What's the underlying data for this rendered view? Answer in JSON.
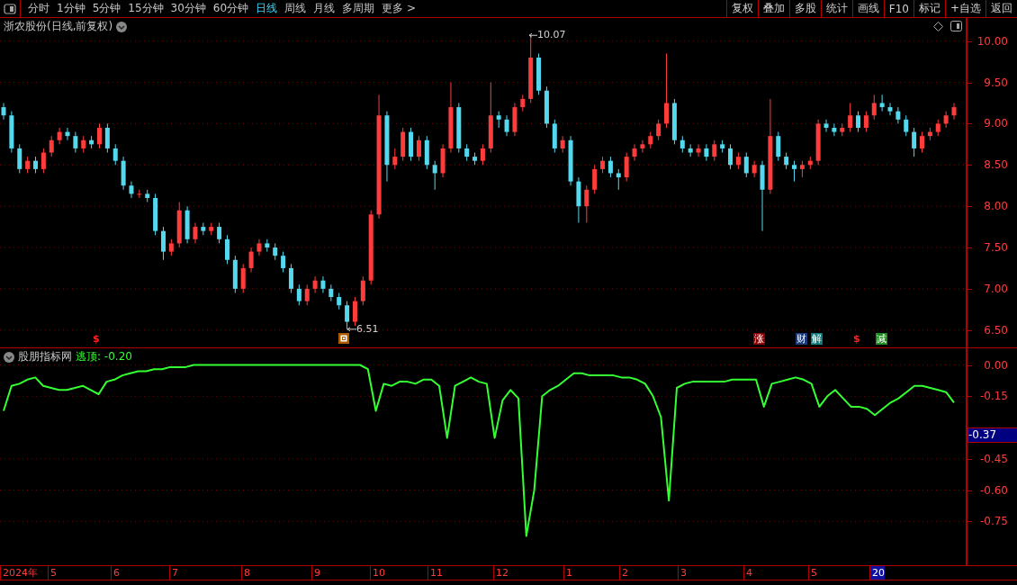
{
  "toolbar": {
    "tabs": [
      {
        "label": "分时",
        "selected": false
      },
      {
        "label": "1分钟",
        "selected": false
      },
      {
        "label": "5分钟",
        "selected": false
      },
      {
        "label": "15分钟",
        "selected": false
      },
      {
        "label": "30分钟",
        "selected": false
      },
      {
        "label": "60分钟",
        "selected": false
      },
      {
        "label": "日线",
        "selected": true
      },
      {
        "label": "周线",
        "selected": false
      },
      {
        "label": "月线",
        "selected": false
      },
      {
        "label": "多周期",
        "selected": false
      },
      {
        "label": "更多 >",
        "selected": false
      }
    ],
    "buttons": [
      "复权",
      "叠加",
      "多股",
      "统计",
      "画线",
      "F10",
      "标记",
      "+自选",
      "返回"
    ]
  },
  "price_panel": {
    "title": "浙农股份(日线,前复权)",
    "high_label": "10.07",
    "low_label": "6.51",
    "markers": [
      {
        "kind": "dollar",
        "text": "$"
      },
      {
        "kind": "box"
      },
      {
        "kind": "tag",
        "text": "涨",
        "color": "#8b0000"
      },
      {
        "kind": "tag",
        "text": "财",
        "color": "#1a3a7a"
      },
      {
        "kind": "tag",
        "text": "解",
        "color": "#0e7a7a"
      },
      {
        "kind": "dollar",
        "text": "$"
      },
      {
        "kind": "tag",
        "text": "减",
        "color": "#1e8a1e"
      }
    ],
    "chart_data": {
      "type": "candlestick",
      "ylim": [
        6.29,
        10.28
      ],
      "grid": true,
      "yticks": [
        {
          "value": 10,
          "label": "10.00"
        },
        {
          "value": 9.5,
          "label": "9.50"
        },
        {
          "value": 9,
          "label": "9.00"
        },
        {
          "value": 8.5,
          "label": "8.50"
        },
        {
          "value": 8,
          "label": "8.00"
        },
        {
          "value": 7.5,
          "label": "7.50"
        },
        {
          "value": 7,
          "label": "7.00"
        },
        {
          "value": 6.5,
          "label": "6.50"
        }
      ],
      "categories": [
        null,
        null,
        null,
        null,
        null,
        null,
        null,
        null,
        null,
        null,
        null,
        null,
        null,
        null,
        null,
        null,
        null,
        null,
        null,
        null,
        null,
        null,
        null,
        null,
        null,
        null,
        null,
        null,
        null,
        null,
        null,
        null,
        null,
        null,
        null,
        null,
        null,
        null,
        null,
        null,
        null,
        null,
        null,
        null,
        null,
        null,
        null,
        null,
        null,
        null,
        null,
        null,
        null,
        null,
        null,
        null,
        null,
        null,
        null,
        null,
        null,
        null,
        null,
        null,
        null,
        null,
        null,
        null,
        null,
        null,
        null,
        null,
        null,
        null,
        null,
        null,
        null,
        null,
        null,
        null,
        null,
        null,
        null,
        null,
        null,
        null,
        null,
        null,
        null,
        null,
        null,
        null,
        null,
        null,
        null,
        null,
        null,
        null,
        null,
        null,
        null,
        null,
        null,
        null,
        null,
        null,
        null,
        null,
        null,
        null,
        null,
        null,
        null,
        null,
        null,
        null,
        null,
        null,
        null,
        null
      ],
      "ohlc": [
        [
          9.2,
          9.25,
          9.05,
          9.1
        ],
        [
          9.1,
          9.15,
          8.65,
          8.7
        ],
        [
          8.7,
          8.75,
          8.4,
          8.45
        ],
        [
          8.45,
          8.6,
          8.4,
          8.55
        ],
        [
          8.55,
          8.6,
          8.4,
          8.45
        ],
        [
          8.45,
          8.7,
          8.4,
          8.65
        ],
        [
          8.65,
          8.85,
          8.6,
          8.8
        ],
        [
          8.8,
          8.95,
          8.75,
          8.9
        ],
        [
          8.9,
          8.95,
          8.8,
          8.85
        ],
        [
          8.85,
          8.9,
          8.65,
          8.7
        ],
        [
          8.7,
          8.85,
          8.65,
          8.8
        ],
        [
          8.8,
          8.85,
          8.7,
          8.75
        ],
        [
          8.75,
          9.0,
          8.7,
          8.95
        ],
        [
          8.95,
          9.0,
          8.65,
          8.7
        ],
        [
          8.7,
          8.75,
          8.5,
          8.55
        ],
        [
          8.55,
          8.6,
          8.2,
          8.25
        ],
        [
          8.25,
          8.3,
          8.1,
          8.15
        ],
        [
          8.15,
          8.2,
          8.1,
          8.15
        ],
        [
          8.15,
          8.2,
          8.05,
          8.1
        ],
        [
          8.1,
          8.15,
          7.65,
          7.7
        ],
        [
          7.7,
          7.75,
          7.35,
          7.45
        ],
        [
          7.45,
          7.6,
          7.4,
          7.55
        ],
        [
          7.55,
          8.05,
          7.5,
          7.95
        ],
        [
          7.95,
          8.0,
          7.55,
          7.6
        ],
        [
          7.6,
          7.8,
          7.55,
          7.75
        ],
        [
          7.75,
          7.8,
          7.65,
          7.7
        ],
        [
          7.7,
          7.8,
          7.65,
          7.75
        ],
        [
          7.75,
          7.8,
          7.55,
          7.6
        ],
        [
          7.6,
          7.65,
          7.3,
          7.35
        ],
        [
          7.35,
          7.4,
          6.95,
          7.0
        ],
        [
          7.0,
          7.3,
          6.95,
          7.25
        ],
        [
          7.25,
          7.5,
          7.2,
          7.45
        ],
        [
          7.45,
          7.6,
          7.4,
          7.55
        ],
        [
          7.55,
          7.6,
          7.45,
          7.5
        ],
        [
          7.5,
          7.55,
          7.35,
          7.4
        ],
        [
          7.4,
          7.45,
          7.2,
          7.25
        ],
        [
          7.25,
          7.3,
          6.95,
          7.0
        ],
        [
          7.0,
          7.05,
          6.8,
          6.85
        ],
        [
          6.85,
          7.05,
          6.8,
          7.0
        ],
        [
          7.0,
          7.15,
          6.95,
          7.1
        ],
        [
          7.1,
          7.15,
          6.95,
          7.0
        ],
        [
          7.0,
          7.05,
          6.85,
          6.9
        ],
        [
          6.9,
          6.95,
          6.75,
          6.8
        ],
        [
          6.8,
          6.85,
          6.51,
          6.6
        ],
        [
          6.6,
          6.9,
          6.55,
          6.85
        ],
        [
          6.85,
          7.15,
          6.8,
          7.1
        ],
        [
          7.1,
          7.95,
          7.05,
          7.9
        ],
        [
          7.9,
          9.35,
          7.85,
          9.1
        ],
        [
          9.1,
          9.15,
          8.3,
          8.5
        ],
        [
          8.5,
          8.7,
          8.45,
          8.6
        ],
        [
          8.6,
          8.95,
          8.55,
          8.9
        ],
        [
          8.9,
          8.95,
          8.55,
          8.6
        ],
        [
          8.6,
          8.85,
          8.55,
          8.8
        ],
        [
          8.8,
          8.85,
          8.45,
          8.5
        ],
        [
          8.5,
          8.55,
          8.2,
          8.4
        ],
        [
          8.4,
          8.75,
          8.35,
          8.7
        ],
        [
          8.7,
          9.5,
          8.65,
          9.2
        ],
        [
          9.2,
          9.25,
          8.65,
          8.7
        ],
        [
          8.7,
          8.75,
          8.55,
          8.6
        ],
        [
          8.6,
          8.65,
          8.5,
          8.55
        ],
        [
          8.55,
          8.75,
          8.5,
          8.7
        ],
        [
          8.7,
          9.5,
          8.65,
          9.1
        ],
        [
          9.1,
          9.15,
          8.95,
          9.05
        ],
        [
          9.05,
          9.1,
          8.85,
          8.9
        ],
        [
          8.9,
          9.25,
          8.85,
          9.2
        ],
        [
          9.2,
          9.35,
          9.15,
          9.3
        ],
        [
          9.3,
          10.07,
          9.25,
          9.8
        ],
        [
          9.8,
          9.85,
          9.35,
          9.4
        ],
        [
          9.4,
          9.45,
          8.95,
          9.0
        ],
        [
          9.0,
          9.05,
          8.65,
          8.7
        ],
        [
          8.7,
          8.85,
          8.65,
          8.8
        ],
        [
          8.8,
          8.85,
          8.25,
          8.3
        ],
        [
          8.3,
          8.35,
          7.8,
          8.0
        ],
        [
          8.0,
          8.25,
          7.8,
          8.2
        ],
        [
          8.2,
          8.5,
          8.15,
          8.45
        ],
        [
          8.45,
          8.6,
          8.4,
          8.55
        ],
        [
          8.55,
          8.6,
          8.35,
          8.4
        ],
        [
          8.4,
          8.45,
          8.2,
          8.35
        ],
        [
          8.35,
          8.65,
          8.3,
          8.6
        ],
        [
          8.6,
          8.75,
          8.55,
          8.7
        ],
        [
          8.7,
          8.8,
          8.65,
          8.75
        ],
        [
          8.75,
          8.9,
          8.7,
          8.85
        ],
        [
          8.85,
          9.05,
          8.8,
          9.0
        ],
        [
          9.0,
          9.85,
          8.95,
          9.25
        ],
        [
          9.25,
          9.3,
          8.75,
          8.8
        ],
        [
          8.8,
          8.85,
          8.65,
          8.7
        ],
        [
          8.7,
          8.75,
          8.6,
          8.65
        ],
        [
          8.65,
          8.75,
          8.6,
          8.7
        ],
        [
          8.7,
          8.75,
          8.55,
          8.6
        ],
        [
          8.6,
          8.8,
          8.55,
          8.75
        ],
        [
          8.75,
          8.8,
          8.65,
          8.7
        ],
        [
          8.7,
          8.75,
          8.45,
          8.5
        ],
        [
          8.5,
          8.65,
          8.45,
          8.6
        ],
        [
          8.6,
          8.65,
          8.35,
          8.4
        ],
        [
          8.4,
          8.55,
          8.35,
          8.5
        ],
        [
          8.5,
          8.55,
          7.7,
          8.2
        ],
        [
          8.2,
          9.3,
          8.15,
          8.85
        ],
        [
          8.85,
          8.9,
          8.55,
          8.6
        ],
        [
          8.6,
          8.65,
          8.45,
          8.5
        ],
        [
          8.5,
          8.55,
          8.3,
          8.45
        ],
        [
          8.45,
          8.55,
          8.35,
          8.5
        ],
        [
          8.5,
          8.6,
          8.45,
          8.55
        ],
        [
          8.55,
          9.05,
          8.5,
          9.0
        ],
        [
          9.0,
          9.05,
          8.9,
          8.95
        ],
        [
          8.95,
          9.0,
          8.85,
          8.9
        ],
        [
          8.9,
          9.0,
          8.85,
          8.95
        ],
        [
          8.95,
          9.25,
          8.9,
          9.1
        ],
        [
          9.1,
          9.15,
          8.9,
          8.95
        ],
        [
          8.95,
          9.15,
          8.9,
          9.1
        ],
        [
          9.1,
          9.35,
          9.05,
          9.25
        ],
        [
          9.25,
          9.35,
          9.15,
          9.2
        ],
        [
          9.2,
          9.25,
          9.1,
          9.15
        ],
        [
          9.15,
          9.2,
          9.0,
          9.05
        ],
        [
          9.05,
          9.1,
          8.85,
          8.9
        ],
        [
          8.9,
          8.95,
          8.6,
          8.7
        ],
        [
          8.7,
          8.9,
          8.65,
          8.85
        ],
        [
          8.85,
          8.95,
          8.8,
          8.9
        ],
        [
          8.9,
          9.05,
          8.85,
          9.0
        ],
        [
          9.0,
          9.15,
          8.95,
          9.1
        ],
        [
          9.1,
          9.25,
          9.05,
          9.2
        ]
      ]
    }
  },
  "indicator_panel": {
    "name": "股朋指标网",
    "value_label": "逃顶: -0.20",
    "cursor_value": "-0.37",
    "chart_data": {
      "type": "line",
      "ylim": [
        -0.96,
        0.08
      ],
      "grid": true,
      "yticks": [
        {
          "value": 0,
          "label": "0.00"
        },
        {
          "value": -0.15,
          "label": "-0.15"
        },
        {
          "value": -0.45,
          "label": "-0.45"
        },
        {
          "value": -0.6,
          "label": "-0.60"
        },
        {
          "value": -0.75,
          "label": "-0.75"
        }
      ],
      "categories": [
        null,
        null,
        null,
        null,
        null,
        null,
        null,
        null,
        null,
        null,
        null,
        null,
        null,
        null,
        null,
        null,
        null,
        null,
        null,
        null,
        null,
        null,
        null,
        null,
        null,
        null,
        null,
        null,
        null,
        null,
        null,
        null,
        null,
        null,
        null,
        null,
        null,
        null,
        null,
        null,
        null,
        null,
        null,
        null,
        null,
        null,
        null,
        null,
        null,
        null,
        null,
        null,
        null,
        null,
        null,
        null,
        null,
        null,
        null,
        null,
        null,
        null,
        null,
        null,
        null,
        null,
        null,
        null,
        null,
        null,
        null,
        null,
        null,
        null,
        null,
        null,
        null,
        null,
        null,
        null,
        null,
        null,
        null,
        null,
        null,
        null,
        null,
        null,
        null,
        null,
        null,
        null,
        null,
        null,
        null,
        null,
        null,
        null,
        null,
        null,
        null,
        null,
        null,
        null,
        null,
        null,
        null,
        null,
        null,
        null,
        null,
        null,
        null,
        null,
        null,
        null,
        null,
        null,
        null,
        null,
        null
      ],
      "series": [
        {
          "color": "#33ff33",
          "values": [
            -0.22,
            -0.1,
            -0.09,
            -0.07,
            -0.06,
            -0.1,
            -0.11,
            -0.12,
            -0.12,
            -0.11,
            -0.1,
            -0.12,
            -0.14,
            -0.08,
            -0.07,
            -0.05,
            -0.04,
            -0.03,
            -0.03,
            -0.02,
            -0.02,
            -0.01,
            -0.01,
            -0.01,
            0,
            0,
            0,
            0,
            0,
            0,
            0,
            0,
            0,
            0,
            0,
            0,
            0,
            0,
            0,
            0,
            0,
            0,
            0,
            0,
            0,
            0,
            -0.02,
            -0.22,
            -0.09,
            -0.1,
            -0.08,
            -0.08,
            -0.09,
            -0.07,
            -0.07,
            -0.1,
            -0.35,
            -0.1,
            -0.08,
            -0.06,
            -0.08,
            -0.09,
            -0.35,
            -0.17,
            -0.12,
            -0.16,
            -0.82,
            -0.6,
            -0.15,
            -0.12,
            -0.1,
            -0.07,
            -0.04,
            -0.04,
            -0.05,
            -0.05,
            -0.05,
            -0.05,
            -0.06,
            -0.06,
            -0.07,
            -0.09,
            -0.15,
            -0.25,
            -0.65,
            -0.11,
            -0.09,
            -0.08,
            -0.08,
            -0.08,
            -0.08,
            -0.08,
            -0.07,
            -0.07,
            -0.07,
            -0.07,
            -0.2,
            -0.09,
            -0.08,
            -0.07,
            -0.06,
            -0.07,
            -0.09,
            -0.2,
            -0.15,
            -0.12,
            -0.16,
            -0.2,
            -0.2,
            -0.21,
            -0.24,
            -0.21,
            -0.18,
            -0.16,
            -0.13,
            -0.1,
            -0.1,
            -0.11,
            -0.12,
            -0.13,
            -0.18
          ]
        }
      ]
    }
  },
  "date_axis": [
    {
      "label": "2024年",
      "selected": false
    },
    {
      "label": "5",
      "selected": false
    },
    {
      "label": "6",
      "selected": false
    },
    {
      "label": "7",
      "selected": false
    },
    {
      "label": "8",
      "selected": false
    },
    {
      "label": "9",
      "selected": false
    },
    {
      "label": "10",
      "selected": false
    },
    {
      "label": "11",
      "selected": false
    },
    {
      "label": "12",
      "selected": false
    },
    {
      "label": "1",
      "selected": false
    },
    {
      "label": "2",
      "selected": false
    },
    {
      "label": "3",
      "selected": false
    },
    {
      "label": "4",
      "selected": false
    },
    {
      "label": "5",
      "selected": false
    },
    {
      "label": "20",
      "selected": true
    }
  ]
}
